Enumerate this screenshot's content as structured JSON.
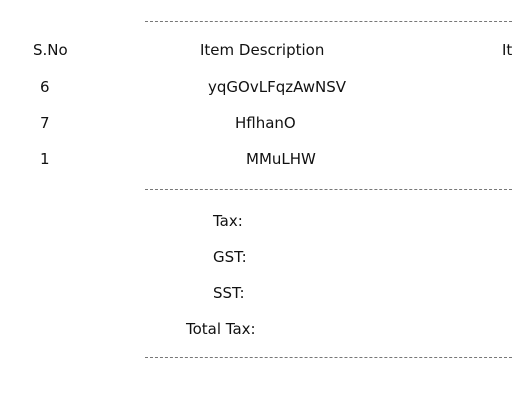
{
  "table": {
    "headers": {
      "sno": "S.No",
      "description": "Item Description",
      "third": "It"
    },
    "rows": [
      {
        "sno": "6",
        "description": "yqGOvLFqzAwNSV"
      },
      {
        "sno": "7",
        "description": "HflhanO"
      },
      {
        "sno": "1",
        "description": "MMuLHW"
      }
    ]
  },
  "tax_summary": {
    "tax_label": "Tax:",
    "gst_label": "GST:",
    "sst_label": "SST:",
    "total_tax_label": "Total Tax:"
  }
}
